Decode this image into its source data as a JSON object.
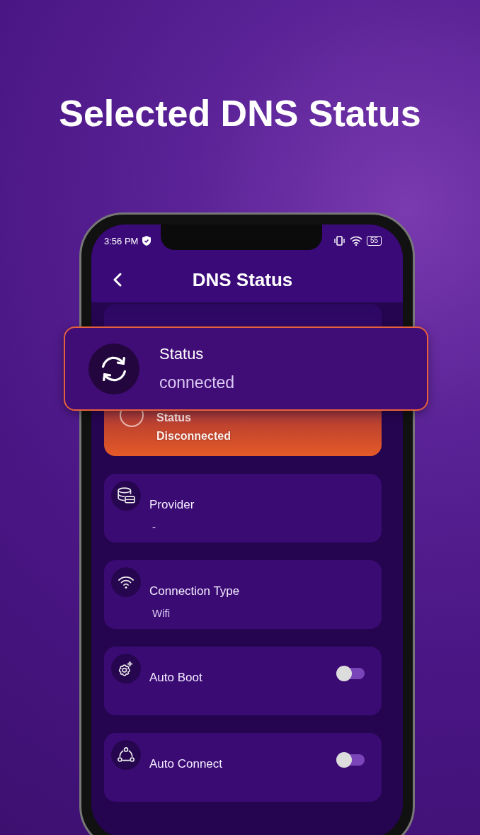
{
  "headline": "Selected DNS Status",
  "status_bar": {
    "time": "3:56 PM",
    "battery": "55"
  },
  "app_bar": {
    "title": "DNS Status"
  },
  "status_card": {
    "label": "Status",
    "value": "Disconnected"
  },
  "callout": {
    "label": "Status",
    "value": "connected"
  },
  "cards": [
    {
      "kind": "info",
      "label": "Provider",
      "value": "-"
    },
    {
      "kind": "info",
      "label": "Connection Type",
      "value": "Wifi"
    },
    {
      "kind": "toggle",
      "label": "Auto Boot",
      "on": false
    },
    {
      "kind": "toggle",
      "label": "Auto Connect",
      "on": false
    }
  ]
}
